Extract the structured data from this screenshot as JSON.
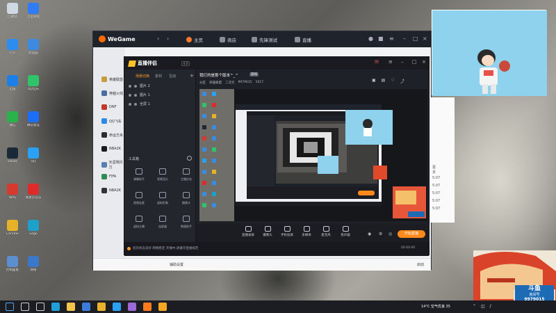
{
  "desktop": {
    "icons": [
      {
        "label": "回收站",
        "color": "#cfd8e3"
      },
      {
        "label": "百度网盘",
        "color": "#2f7cf6"
      },
      {
        "label": "钉钉",
        "color": "#2c8cf0"
      },
      {
        "label": "此电脑",
        "color": "#3c8be0"
      },
      {
        "label": "迅雷",
        "color": "#1d7fe8"
      },
      {
        "label": "QQ音乐",
        "color": "#30c46a"
      },
      {
        "label": "微信",
        "color": "#2ab34a"
      },
      {
        "label": "腾讯会议",
        "color": "#1b6ef5"
      },
      {
        "label": "Steam",
        "color": "#1b2838"
      },
      {
        "label": "QQ",
        "color": "#2aa1f5"
      },
      {
        "label": "WPS",
        "color": "#d63a2f"
      },
      {
        "label": "网易云音乐",
        "color": "#e02a2a"
      },
      {
        "label": "Chrome",
        "color": "#e5b22a"
      },
      {
        "label": "Edge",
        "color": "#1ea1c8"
      },
      {
        "label": "控制面板",
        "color": "#5b8fd0"
      },
      {
        "label": "网络",
        "color": "#3b78c9"
      }
    ]
  },
  "wegame": {
    "brand": "WeGame",
    "nav": [
      {
        "label": "主页",
        "active": true
      },
      {
        "label": "商店",
        "active": false
      },
      {
        "label": "先锋测试",
        "active": false
      },
      {
        "label": "直播",
        "active": false
      }
    ],
    "sidebar": [
      {
        "label": "英雄联盟",
        "color": "#c89b3c"
      },
      {
        "label": "穿越火线",
        "color": "#4a6fa5"
      },
      {
        "label": "DNF",
        "color": "#c0392b"
      },
      {
        "label": "QQ飞车",
        "color": "#2b8be6"
      },
      {
        "label": "命运方舟",
        "color": "#2c2c2c"
      },
      {
        "label": "NBA2K",
        "color": "#1a1a1a"
      },
      {
        "label": "天涯明月刀",
        "color": "#5a7fb5"
      },
      {
        "label": "FIFA",
        "color": "#2e8b57"
      },
      {
        "label": "NBA2K",
        "color": "#333333"
      }
    ],
    "bottom_settings": "辅助设置",
    "bottom_status": "启动",
    "right_snippet": "更多",
    "right_times": [
      "5:07",
      "5:07",
      "5:07",
      "5:07",
      "5:07"
    ]
  },
  "streamer": {
    "brand": "直播伴侣",
    "version": "6.0",
    "tabs": [
      {
        "label": "场景切换",
        "active": true
      },
      {
        "label": "素材",
        "active": false
      },
      {
        "label": "互动",
        "active": false
      }
    ],
    "scenes": [
      "图片 2",
      "图片 1",
      "全屏 1"
    ],
    "tools_title": "工具箱",
    "tools": [
      {
        "label": "弹幕助手"
      },
      {
        "label": "背景音乐"
      },
      {
        "label": "主播任务"
      },
      {
        "label": "视频连麦"
      },
      {
        "label": "虚拟形象"
      },
      {
        "label": "摄像头"
      },
      {
        "label": "虚拟主播"
      },
      {
        "label": "连屏器"
      },
      {
        "label": "数据助手"
      }
    ],
    "stream_title": "我打的是那个版本^_^",
    "stream_tag": "游戏",
    "stream_meta": [
      "分区",
      "英雄联盟",
      "二次元",
      "9979015",
      "1617"
    ],
    "toolbar": [
      {
        "label": "直播录屏"
      },
      {
        "label": "摄像头"
      },
      {
        "label": "手机投屏"
      },
      {
        "label": "多媒体"
      },
      {
        "label": "麦克风"
      },
      {
        "label": "扬声器"
      }
    ],
    "go_live": "开始直播",
    "status_text": "您的状态良好 网络稳定 开播中,请遵守直播规范",
    "status_time": "00:00:00"
  },
  "cam_top": {
    "bg": "#8fd2ee"
  },
  "cam_bottom": {
    "room_label": "房间号",
    "room_number": "9979015"
  },
  "taskbar": {
    "weather": "14°C 空气优良 35",
    "apps": [
      {
        "name": "start",
        "color": "#4fa9f5"
      },
      {
        "name": "search",
        "color": "#cfd3d9"
      },
      {
        "name": "task-view",
        "color": "#cfd3d9"
      },
      {
        "name": "edge",
        "color": "#1f9ed8"
      },
      {
        "name": "file-explorer",
        "color": "#f3c44a"
      },
      {
        "name": "store",
        "color": "#3b7dd8"
      },
      {
        "name": "chrome",
        "color": "#e9b22a"
      },
      {
        "name": "qq-game",
        "color": "#2aa1f5"
      },
      {
        "name": "vs",
        "color": "#9b6ad8"
      },
      {
        "name": "wegame",
        "color": "#ff7a1c"
      },
      {
        "name": "streamer",
        "color": "#f5a623"
      }
    ]
  }
}
